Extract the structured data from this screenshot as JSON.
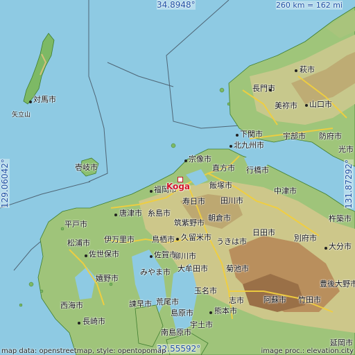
{
  "map": {
    "marker_label": "Koga",
    "top_coord": "34.8948°",
    "bottom_coord": "32.55592°",
    "left_coord": "129.06042°",
    "right_coord": "131.87292°",
    "scale": "260 km = 162 mi",
    "attribution_left": "map data: openstreetmap, style: opentopomap",
    "attribution_right": "image proc.: elevation.city",
    "colors": {
      "sea": "#8ecae3",
      "land_low": "#7fbf6a",
      "land_mid": "#c9c98a",
      "land_high": "#b58a5a",
      "road": "#f3d34a",
      "border": "#5a6b7a"
    }
  },
  "cities": [
    "萩市",
    "長門市",
    "山口市",
    "美祢市",
    "対馬市",
    "矢立山",
    "下関市",
    "宇部市",
    "防府市",
    "北九州市",
    "光市",
    "壱岐市",
    "宗像市",
    "直方市",
    "行橋市",
    "福岡市",
    "飯塚市",
    "中津市",
    "寿日市",
    "田川市",
    "唐津市",
    "糸島市",
    "筑紫野市",
    "朝倉市",
    "平戸市",
    "伊万里市",
    "久留米市",
    "日田市",
    "杵築市",
    "松浦市",
    "鳥栖市",
    "うきは市",
    "別府市",
    "佐世保市",
    "佐賀市",
    "柳川市",
    "大分市",
    "みやま市",
    "大牟田市",
    "菊池市",
    "豊後大野市",
    "嬉野市",
    "荒尾市",
    "玉名市",
    "志市",
    "阿蘇市",
    "竹田市",
    "西海市",
    "諫早市",
    "長崎市",
    "島原市",
    "熊本市",
    "南島原市",
    "宇土市",
    "延岡市"
  ]
}
